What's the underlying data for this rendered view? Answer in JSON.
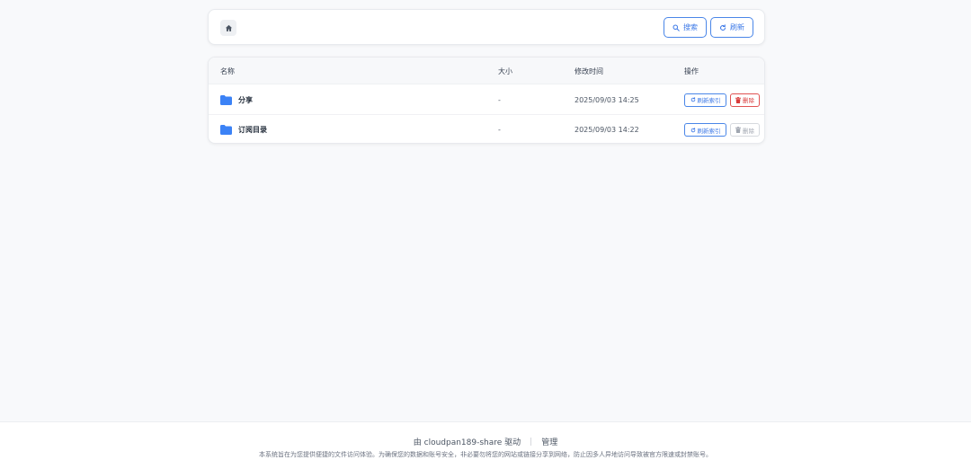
{
  "toolbar": {
    "home_icon": "home-icon",
    "search_label": "搜索",
    "refresh_label": "刷新"
  },
  "table": {
    "headers": {
      "name": "名称",
      "size": "大小",
      "modified": "修改时间",
      "actions": "操作"
    },
    "rows": [
      {
        "name": "分享",
        "size": "-",
        "modified": "2025/09/03 14:25",
        "reindex_label": "刷新索引",
        "delete_label": "删除",
        "delete_enabled": true
      },
      {
        "name": "订阅目录",
        "size": "-",
        "modified": "2025/09/03 14:22",
        "reindex_label": "刷新索引",
        "delete_label": "删除",
        "delete_enabled": false
      }
    ]
  },
  "footer": {
    "powered_by": "由 cloudpan189-share 驱动",
    "separator": "|",
    "admin_link": "管理",
    "notice": "本系统旨在为您提供便捷的文件访问体验。为确保您的数据和账号安全，非必要勿将您的网站或链接分享到网络，防止因多人异地访问导致被官方限速或封禁账号。"
  },
  "colors": {
    "accent": "#3b78e7",
    "danger": "#d93b3b",
    "folder": "#3b82f6",
    "background": "#f8f9fb"
  }
}
